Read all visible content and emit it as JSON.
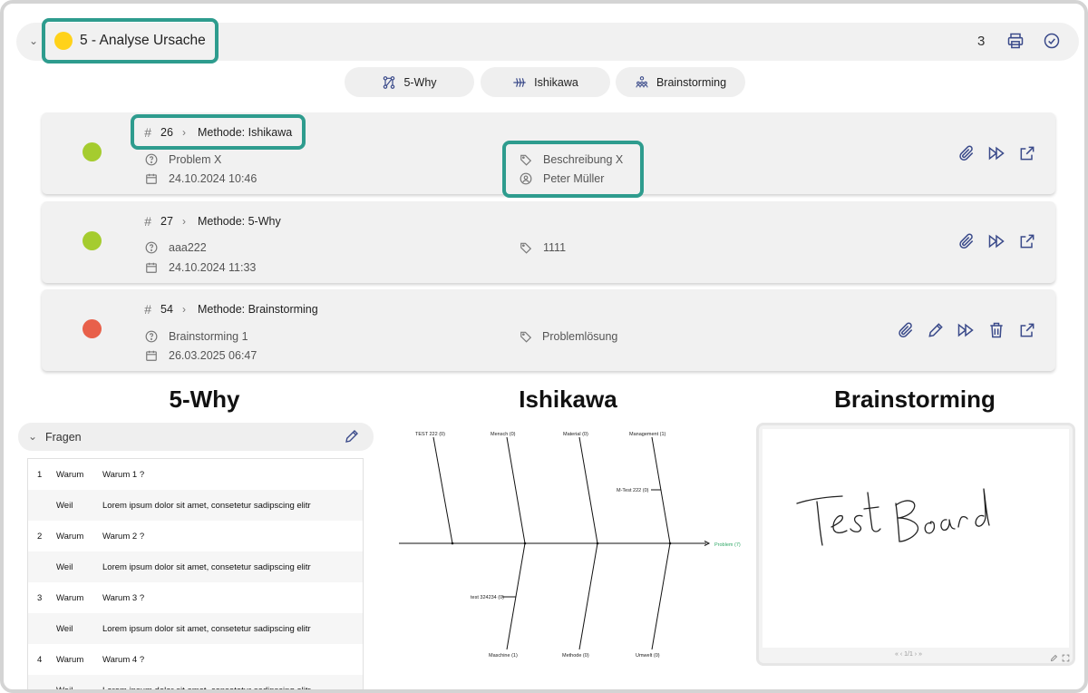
{
  "section": {
    "title": "5 - Analyse Ursache",
    "count": "3",
    "status_color": "#ffd21a"
  },
  "methods": [
    {
      "label": "5-Why",
      "icon": "hierarchy-icon"
    },
    {
      "label": "Ishikawa",
      "icon": "fishbone-icon"
    },
    {
      "label": "Brainstorming",
      "icon": "people-idea-icon"
    }
  ],
  "cards": [
    {
      "id": "26",
      "method": "Methode: Ishikawa",
      "problem": "Problem X",
      "date": "24.10.2024 10:46",
      "tag": "Beschreibung X",
      "user": "Peter Müller",
      "status_color": "#a5cc2f"
    },
    {
      "id": "27",
      "method": "Methode: 5-Why",
      "problem": "aaa222",
      "date": "24.10.2024 11:33",
      "tag": "1111",
      "status_color": "#a5cc2f"
    },
    {
      "id": "54",
      "method": "Methode: Brainstorming",
      "problem": "Brainstorming 1",
      "date": "26.03.2025 06:47",
      "tag": "Problemlösung",
      "status_color": "#e8604a"
    }
  ],
  "previews": {
    "why_title": "5-Why",
    "ishikawa_title": "Ishikawa",
    "brainstorming_title": "Brainstorming"
  },
  "fragen": {
    "label": "Fragen",
    "rows": [
      {
        "num": "1",
        "kind": "Warum",
        "text": "Warum 1 ?"
      },
      {
        "num": "",
        "kind": "Weil",
        "text": "Lorem ipsum dolor sit amet, consetetur sadipscing elitr"
      },
      {
        "num": "2",
        "kind": "Warum",
        "text": "Warum 2 ?"
      },
      {
        "num": "",
        "kind": "Weil",
        "text": "Lorem ipsum dolor sit amet, consetetur sadipscing elitr"
      },
      {
        "num": "3",
        "kind": "Warum",
        "text": "Warum 3 ?"
      },
      {
        "num": "",
        "kind": "Weil",
        "text": "Lorem ipsum dolor sit amet, consetetur sadipscing elitr"
      },
      {
        "num": "4",
        "kind": "Warum",
        "text": "Warum 4 ?"
      },
      {
        "num": "",
        "kind": "Weil",
        "text": "Lorem ipsum dolor sit amet, consetetur sadipscing elitr"
      }
    ]
  },
  "ishikawa": {
    "top": [
      "TEST 222 (0)",
      "Mensch (0)",
      "Material (0)",
      "Management (1)"
    ],
    "bottom": [
      "Maschine (1)",
      "Methode (0)",
      "Umwelt (0)"
    ],
    "sub_top": "M-Test 222 (0)",
    "sub_bottom": "test 324234 (0)",
    "problem": "Problem (7)",
    "problem_color": "#2fa866"
  },
  "board": {
    "handwriting": "Test Board",
    "pager": "« ‹ 1/1 › »"
  }
}
